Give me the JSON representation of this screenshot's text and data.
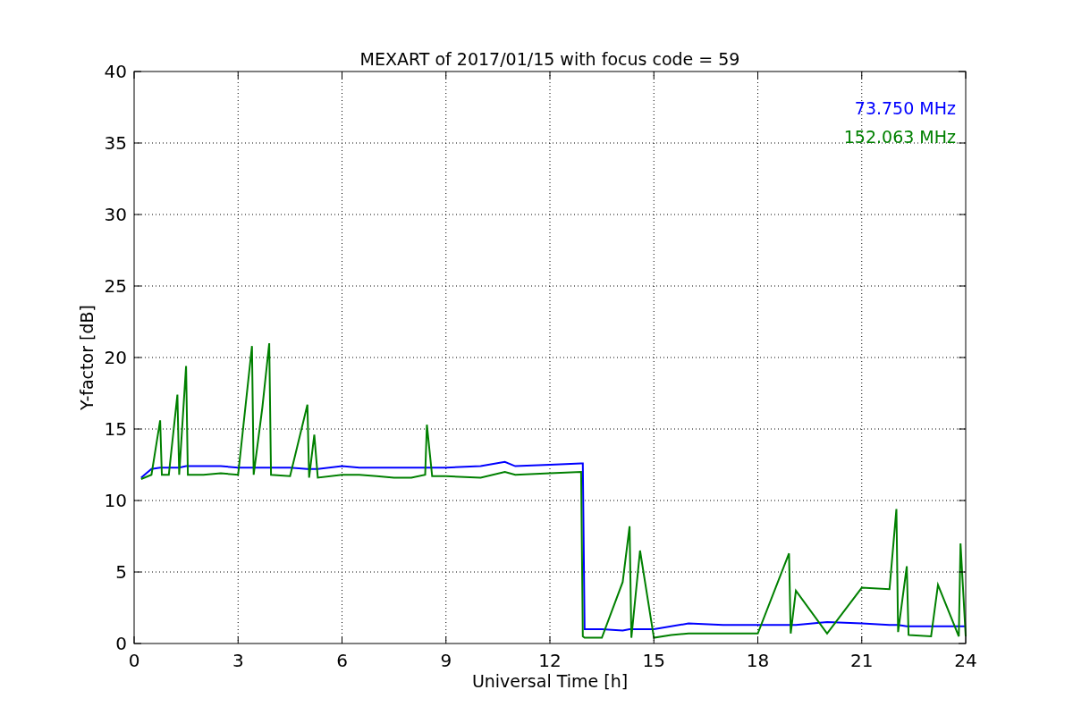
{
  "figure": {
    "chart_data": {
      "type": "line",
      "title": "MEXART of 2017/01/15 with focus code = 59",
      "xlabel": "Universal Time [h]",
      "ylabel": "Y-factor [dB]",
      "x": [
        0.2,
        0.5,
        0.75,
        0.8,
        1.0,
        1.25,
        1.3,
        1.5,
        1.55,
        2.0,
        2.5,
        3.0,
        3.4,
        3.45,
        3.7,
        3.9,
        3.95,
        4.5,
        5.0,
        5.05,
        5.2,
        5.3,
        6.0,
        6.5,
        7.0,
        7.5,
        8.0,
        8.4,
        8.45,
        8.6,
        9.0,
        10.0,
        10.7,
        11.0,
        12.0,
        12.9,
        12.95,
        13.0,
        13.5,
        14.1,
        14.3,
        14.35,
        14.6,
        15.0,
        15.5,
        16.0,
        17.0,
        18.0,
        18.9,
        18.95,
        19.1,
        20.0,
        21.0,
        21.8,
        22.0,
        22.05,
        22.3,
        22.35,
        23.0,
        23.2,
        23.8,
        23.85,
        24.0
      ],
      "series": [
        {
          "name": "73.750 MHz",
          "color": "#0000ff",
          "values": [
            11.6,
            12.2,
            12.3,
            12.3,
            12.3,
            12.3,
            12.3,
            12.4,
            12.4,
            12.4,
            12.4,
            12.3,
            12.3,
            12.3,
            12.3,
            12.3,
            12.3,
            12.3,
            12.2,
            12.2,
            12.2,
            12.2,
            12.4,
            12.3,
            12.3,
            12.3,
            12.3,
            12.3,
            12.3,
            12.3,
            12.3,
            12.4,
            12.7,
            12.4,
            12.5,
            12.6,
            12.6,
            1.0,
            1.0,
            0.9,
            1.0,
            1.0,
            1.0,
            1.0,
            1.2,
            1.4,
            1.3,
            1.3,
            1.3,
            1.3,
            1.3,
            1.5,
            1.4,
            1.3,
            1.3,
            1.3,
            1.2,
            1.2,
            1.2,
            1.2,
            1.2,
            1.2,
            1.2
          ]
        },
        {
          "name": "152.063 MHz",
          "color": "#008000",
          "values": [
            11.5,
            11.8,
            15.6,
            11.8,
            11.8,
            17.4,
            11.8,
            19.4,
            11.8,
            11.8,
            11.9,
            11.8,
            20.8,
            11.8,
            16.5,
            21.0,
            11.8,
            11.7,
            16.7,
            11.6,
            14.6,
            11.6,
            11.8,
            11.8,
            11.7,
            11.6,
            11.6,
            11.8,
            15.3,
            11.7,
            11.7,
            11.6,
            12.0,
            11.8,
            11.9,
            12.0,
            0.5,
            0.4,
            0.4,
            4.3,
            8.2,
            0.4,
            6.5,
            0.4,
            0.6,
            0.7,
            0.7,
            0.7,
            6.3,
            0.7,
            3.7,
            0.7,
            3.9,
            3.8,
            9.4,
            0.8,
            5.4,
            0.6,
            0.5,
            4.1,
            0.5,
            7.0,
            0.5
          ]
        }
      ],
      "grid": true,
      "xlim": [
        0,
        24
      ],
      "ylim": [
        0,
        40
      ],
      "xticks": [
        0,
        3,
        6,
        9,
        12,
        15,
        18,
        21,
        24
      ],
      "yticks": [
        0,
        5,
        10,
        15,
        20,
        25,
        30,
        35,
        40
      ]
    }
  }
}
